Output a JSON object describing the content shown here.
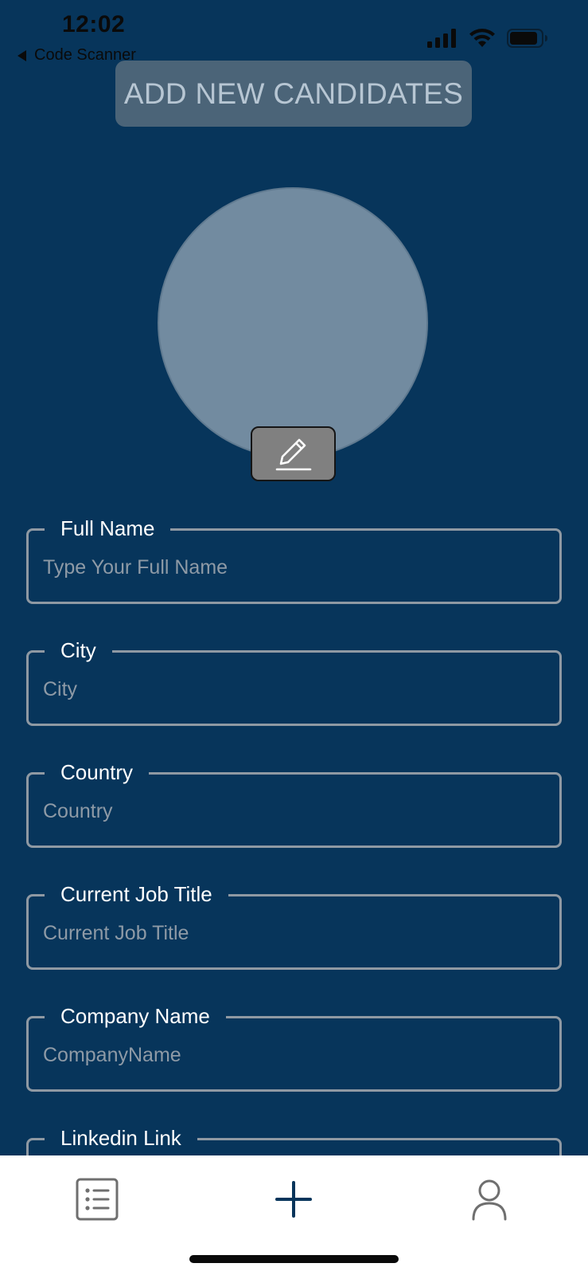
{
  "status_bar": {
    "time": "12:02",
    "back_label": "Code Scanner"
  },
  "header": {
    "title": "ADD NEW CANDIDATES"
  },
  "form": {
    "fields": [
      {
        "label": "Full Name",
        "placeholder": "Type Your Full Name",
        "value": ""
      },
      {
        "label": "City",
        "placeholder": "City",
        "value": ""
      },
      {
        "label": "Country",
        "placeholder": "Country",
        "value": ""
      },
      {
        "label": "Current Job Title",
        "placeholder": "Current Job Title",
        "value": ""
      },
      {
        "label": "Company Name",
        "placeholder": "CompanyName",
        "value": ""
      },
      {
        "label": "Linkedin Link",
        "placeholder": "",
        "value": ""
      }
    ]
  },
  "tab_bar": {
    "tabs": [
      {
        "icon": "list-icon"
      },
      {
        "icon": "plus-icon"
      },
      {
        "icon": "person-icon"
      }
    ]
  },
  "colors": {
    "background": "#07355b",
    "title_pill": "#4b6478",
    "avatar": "#728ba0",
    "edit_button": "#808080",
    "field_border": "#8f99a3",
    "tab_bar": "#ffffff"
  }
}
